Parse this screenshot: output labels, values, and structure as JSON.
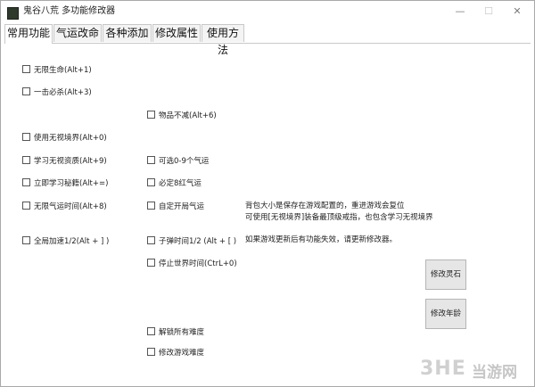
{
  "window": {
    "title": "鬼谷八荒 多功能修改器",
    "controls": {
      "minimize": "—",
      "maximize": "☐",
      "close": "✕"
    }
  },
  "tabs": [
    {
      "label": "常用功能",
      "active": true
    },
    {
      "label": "气运改命",
      "active": false
    },
    {
      "label": "各种添加",
      "active": false
    },
    {
      "label": "修改属性",
      "active": false
    },
    {
      "label": "使用方法",
      "active": false
    }
  ],
  "checkboxes": {
    "infinite_life": "无限生命(Alt+1)",
    "one_hit_kill": "一击必杀(Alt+3)",
    "items_no_decrease": "物品不减(Alt+6)",
    "use_ignore_realm": "使用无视境界(Alt+0)",
    "learn_ignore_aptitude": "学习无视资质(Alt+9)",
    "choose_0_9_luck": "可选0-9个气运",
    "learn_secrets_instantly": "立即学习秘籍(Alt+=)",
    "guaranteed_8_red_luck": "必定8红气运",
    "infinite_luck_time": "无限气运时间(Alt+8)",
    "custom_opening_luck": "自定开局气运",
    "global_speed_half": "全局加速1/2(Alt + ] )",
    "bullet_time_half": "子弹时间1/2 (Alt + [ )",
    "stop_world_time": "停止世界时间(CtrL+0)",
    "unlock_all_difficulties": "解锁所有难度",
    "modify_game_difficulty": "修改游戏难度"
  },
  "notes": {
    "line1": "背包大小是保存在游戏配置的，重进游戏会复位",
    "line2": "可使用[无视境界]装备最顶级戒指，也包含学习无视境界",
    "line3": "如果游戏更新后有功能失效，请更新修改器。"
  },
  "buttons": {
    "modify_spirit_stones": "修改灵石",
    "modify_age": "修改年龄"
  },
  "watermark": {
    "logo": "3HE",
    "site": "当游网"
  },
  "colors": {
    "accent_icon": "#2f3a2c",
    "button_bg": "#e6e6e6",
    "border": "#c8c8c8"
  }
}
